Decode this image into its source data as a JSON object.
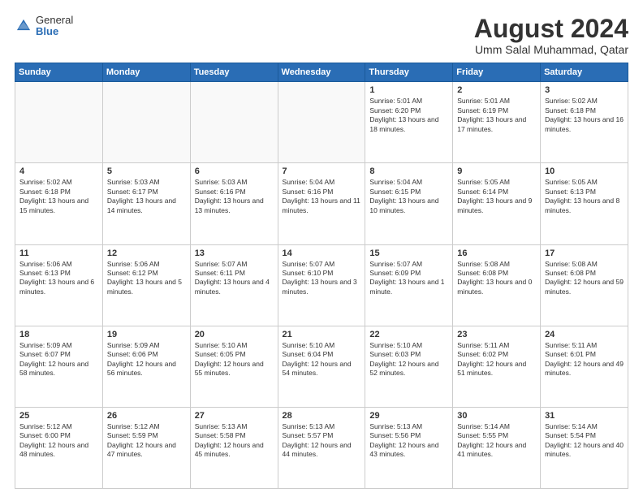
{
  "header": {
    "logo": {
      "general": "General",
      "blue": "Blue"
    },
    "title": "August 2024",
    "subtitle": "Umm Salal Muhammad, Qatar"
  },
  "calendar": {
    "weekdays": [
      "Sunday",
      "Monday",
      "Tuesday",
      "Wednesday",
      "Thursday",
      "Friday",
      "Saturday"
    ],
    "weeks": [
      [
        {
          "day": "",
          "empty": true
        },
        {
          "day": "",
          "empty": true
        },
        {
          "day": "",
          "empty": true
        },
        {
          "day": "",
          "empty": true
        },
        {
          "day": "1",
          "sunrise": "5:01 AM",
          "sunset": "6:20 PM",
          "daylight": "13 hours and 18 minutes."
        },
        {
          "day": "2",
          "sunrise": "5:01 AM",
          "sunset": "6:19 PM",
          "daylight": "13 hours and 17 minutes."
        },
        {
          "day": "3",
          "sunrise": "5:02 AM",
          "sunset": "6:18 PM",
          "daylight": "13 hours and 16 minutes."
        }
      ],
      [
        {
          "day": "4",
          "sunrise": "5:02 AM",
          "sunset": "6:18 PM",
          "daylight": "13 hours and 15 minutes."
        },
        {
          "day": "5",
          "sunrise": "5:03 AM",
          "sunset": "6:17 PM",
          "daylight": "13 hours and 14 minutes."
        },
        {
          "day": "6",
          "sunrise": "5:03 AM",
          "sunset": "6:16 PM",
          "daylight": "13 hours and 13 minutes."
        },
        {
          "day": "7",
          "sunrise": "5:04 AM",
          "sunset": "6:16 PM",
          "daylight": "13 hours and 11 minutes."
        },
        {
          "day": "8",
          "sunrise": "5:04 AM",
          "sunset": "6:15 PM",
          "daylight": "13 hours and 10 minutes."
        },
        {
          "day": "9",
          "sunrise": "5:05 AM",
          "sunset": "6:14 PM",
          "daylight": "13 hours and 9 minutes."
        },
        {
          "day": "10",
          "sunrise": "5:05 AM",
          "sunset": "6:13 PM",
          "daylight": "13 hours and 8 minutes."
        }
      ],
      [
        {
          "day": "11",
          "sunrise": "5:06 AM",
          "sunset": "6:13 PM",
          "daylight": "13 hours and 6 minutes."
        },
        {
          "day": "12",
          "sunrise": "5:06 AM",
          "sunset": "6:12 PM",
          "daylight": "13 hours and 5 minutes."
        },
        {
          "day": "13",
          "sunrise": "5:07 AM",
          "sunset": "6:11 PM",
          "daylight": "13 hours and 4 minutes."
        },
        {
          "day": "14",
          "sunrise": "5:07 AM",
          "sunset": "6:10 PM",
          "daylight": "13 hours and 3 minutes."
        },
        {
          "day": "15",
          "sunrise": "5:07 AM",
          "sunset": "6:09 PM",
          "daylight": "13 hours and 1 minute."
        },
        {
          "day": "16",
          "sunrise": "5:08 AM",
          "sunset": "6:08 PM",
          "daylight": "13 hours and 0 minutes."
        },
        {
          "day": "17",
          "sunrise": "5:08 AM",
          "sunset": "6:08 PM",
          "daylight": "12 hours and 59 minutes."
        }
      ],
      [
        {
          "day": "18",
          "sunrise": "5:09 AM",
          "sunset": "6:07 PM",
          "daylight": "12 hours and 58 minutes."
        },
        {
          "day": "19",
          "sunrise": "5:09 AM",
          "sunset": "6:06 PM",
          "daylight": "12 hours and 56 minutes."
        },
        {
          "day": "20",
          "sunrise": "5:10 AM",
          "sunset": "6:05 PM",
          "daylight": "12 hours and 55 minutes."
        },
        {
          "day": "21",
          "sunrise": "5:10 AM",
          "sunset": "6:04 PM",
          "daylight": "12 hours and 54 minutes."
        },
        {
          "day": "22",
          "sunrise": "5:10 AM",
          "sunset": "6:03 PM",
          "daylight": "12 hours and 52 minutes."
        },
        {
          "day": "23",
          "sunrise": "5:11 AM",
          "sunset": "6:02 PM",
          "daylight": "12 hours and 51 minutes."
        },
        {
          "day": "24",
          "sunrise": "5:11 AM",
          "sunset": "6:01 PM",
          "daylight": "12 hours and 49 minutes."
        }
      ],
      [
        {
          "day": "25",
          "sunrise": "5:12 AM",
          "sunset": "6:00 PM",
          "daylight": "12 hours and 48 minutes."
        },
        {
          "day": "26",
          "sunrise": "5:12 AM",
          "sunset": "5:59 PM",
          "daylight": "12 hours and 47 minutes."
        },
        {
          "day": "27",
          "sunrise": "5:13 AM",
          "sunset": "5:58 PM",
          "daylight": "12 hours and 45 minutes."
        },
        {
          "day": "28",
          "sunrise": "5:13 AM",
          "sunset": "5:57 PM",
          "daylight": "12 hours and 44 minutes."
        },
        {
          "day": "29",
          "sunrise": "5:13 AM",
          "sunset": "5:56 PM",
          "daylight": "12 hours and 43 minutes."
        },
        {
          "day": "30",
          "sunrise": "5:14 AM",
          "sunset": "5:55 PM",
          "daylight": "12 hours and 41 minutes."
        },
        {
          "day": "31",
          "sunrise": "5:14 AM",
          "sunset": "5:54 PM",
          "daylight": "12 hours and 40 minutes."
        }
      ]
    ]
  }
}
